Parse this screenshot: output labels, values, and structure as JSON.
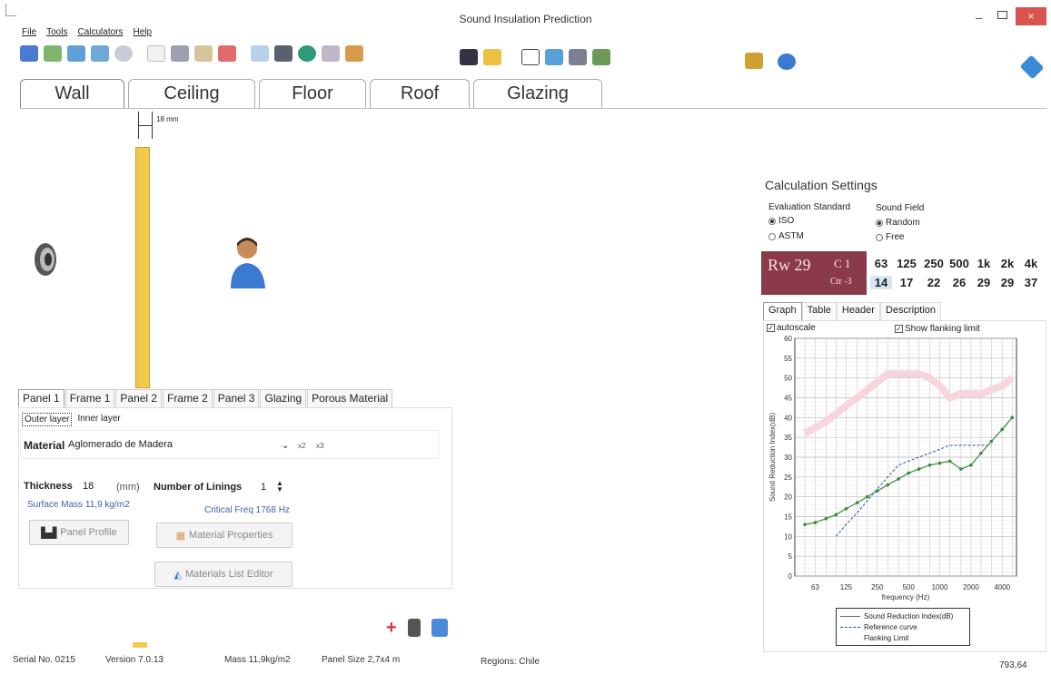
{
  "window": {
    "title": "Sound Insulation Prediction",
    "min": "–",
    "close": "×"
  },
  "menu": [
    "File",
    "Tools",
    "Calculators",
    "Help"
  ],
  "main_tabs": [
    "Wall",
    "Ceiling",
    "Floor",
    "Roof",
    "Glazing"
  ],
  "drawing": {
    "thickness_label": "18 mm"
  },
  "panel_tabs": [
    "Panel 1",
    "Frame 1",
    "Panel 2",
    "Frame 2",
    "Panel 3",
    "Glazing",
    "Porous Material"
  ],
  "layer_tabs": [
    "Outer layer",
    "Inner layer"
  ],
  "material": {
    "label": "Material",
    "value": "Aglomerado de Madera",
    "x2": "x2",
    "x3": "x3",
    "thickness_label": "Thickness",
    "thickness_value": "18",
    "thickness_unit": "(mm)",
    "linings_label": "Number of Linings",
    "linings_value": "1",
    "surface_mass": "Surface Mass 11,9 kg/m2",
    "critical_freq": "Critical Freq 1768 Hz",
    "btn_profile": "Panel Profile",
    "btn_properties": "Material Properties",
    "btn_list_editor": "Materials List Editor"
  },
  "status": {
    "serial": "Serial No. 0215",
    "version": "Version 7.0.13",
    "mass": "Mass 11,9kg/m2",
    "panel_size": "Panel Size 2,7x4 m",
    "regions": "Regions: Chile",
    "coords": "793,64"
  },
  "calc_settings": {
    "title": "Calculation Settings",
    "eval_label": "Evaluation Standard",
    "eval_options": [
      "ISO",
      "ASTM"
    ],
    "eval_selected": 0,
    "field_label": "Sound Field",
    "field_options": [
      "Random",
      "Free"
    ],
    "field_selected": 0
  },
  "rating": {
    "rw": "Rw 29",
    "c": "C 1",
    "ctr": "Ctr -3",
    "freqs": [
      "63",
      "125",
      "250",
      "500",
      "1k",
      "2k",
      "4k"
    ],
    "values": [
      "14",
      "17",
      "22",
      "26",
      "29",
      "29",
      "37"
    ]
  },
  "graph_tabs": [
    "Graph",
    "Table",
    "Header",
    "Description"
  ],
  "graph_options": {
    "autoscale": "autoscale",
    "flanking": "Show flanking limit",
    "check": "✓"
  },
  "chart_data": {
    "type": "line",
    "xlabel": "frequency (Hz)",
    "ylabel": "Sound Reduction Index(dB)",
    "ylim": [
      0,
      60
    ],
    "yticks": [
      0,
      5,
      10,
      15,
      20,
      25,
      30,
      35,
      40,
      45,
      50,
      55,
      60
    ],
    "xlim": [
      40,
      5500
    ],
    "xscale": "log",
    "xticks": [
      63,
      125,
      250,
      500,
      1000,
      2000,
      4000
    ],
    "grid": true,
    "legend_position": "bottom",
    "series": [
      {
        "name": "Sound Reduction Index(dB)",
        "color": "#3a8a3a",
        "style": "solid-marker",
        "x": [
          50,
          63,
          80,
          100,
          125,
          160,
          200,
          250,
          315,
          400,
          500,
          630,
          800,
          1000,
          1250,
          1600,
          2000,
          2500,
          3150,
          4000,
          5000
        ],
        "y": [
          13,
          13.5,
          14.5,
          15.5,
          17,
          18.5,
          20,
          21.5,
          23,
          24.5,
          26,
          27,
          28,
          28.5,
          29,
          27,
          28,
          31,
          34,
          37,
          40
        ]
      },
      {
        "name": "Reference curve",
        "color": "#2255aa",
        "style": "dashed",
        "x": [
          100,
          125,
          160,
          200,
          250,
          315,
          400,
          500,
          630,
          800,
          1000,
          1250,
          1600,
          2000,
          2500,
          3150
        ],
        "y": [
          10,
          13,
          16,
          19,
          22,
          25,
          28,
          29,
          30,
          31,
          32,
          33,
          33,
          33,
          33,
          33
        ]
      },
      {
        "name": "Flanking Limit",
        "color": "#f6d5dc",
        "style": "thick",
        "x": [
          50,
          63,
          80,
          100,
          125,
          160,
          200,
          250,
          315,
          400,
          500,
          630,
          800,
          1000,
          1250,
          1600,
          2000,
          2500,
          3150,
          4000,
          5000
        ],
        "y": [
          36,
          37.5,
          39,
          41,
          43,
          45,
          47,
          49,
          51,
          51,
          51,
          51,
          50,
          48,
          45,
          46,
          46,
          46,
          47,
          48,
          50
        ]
      }
    ]
  }
}
